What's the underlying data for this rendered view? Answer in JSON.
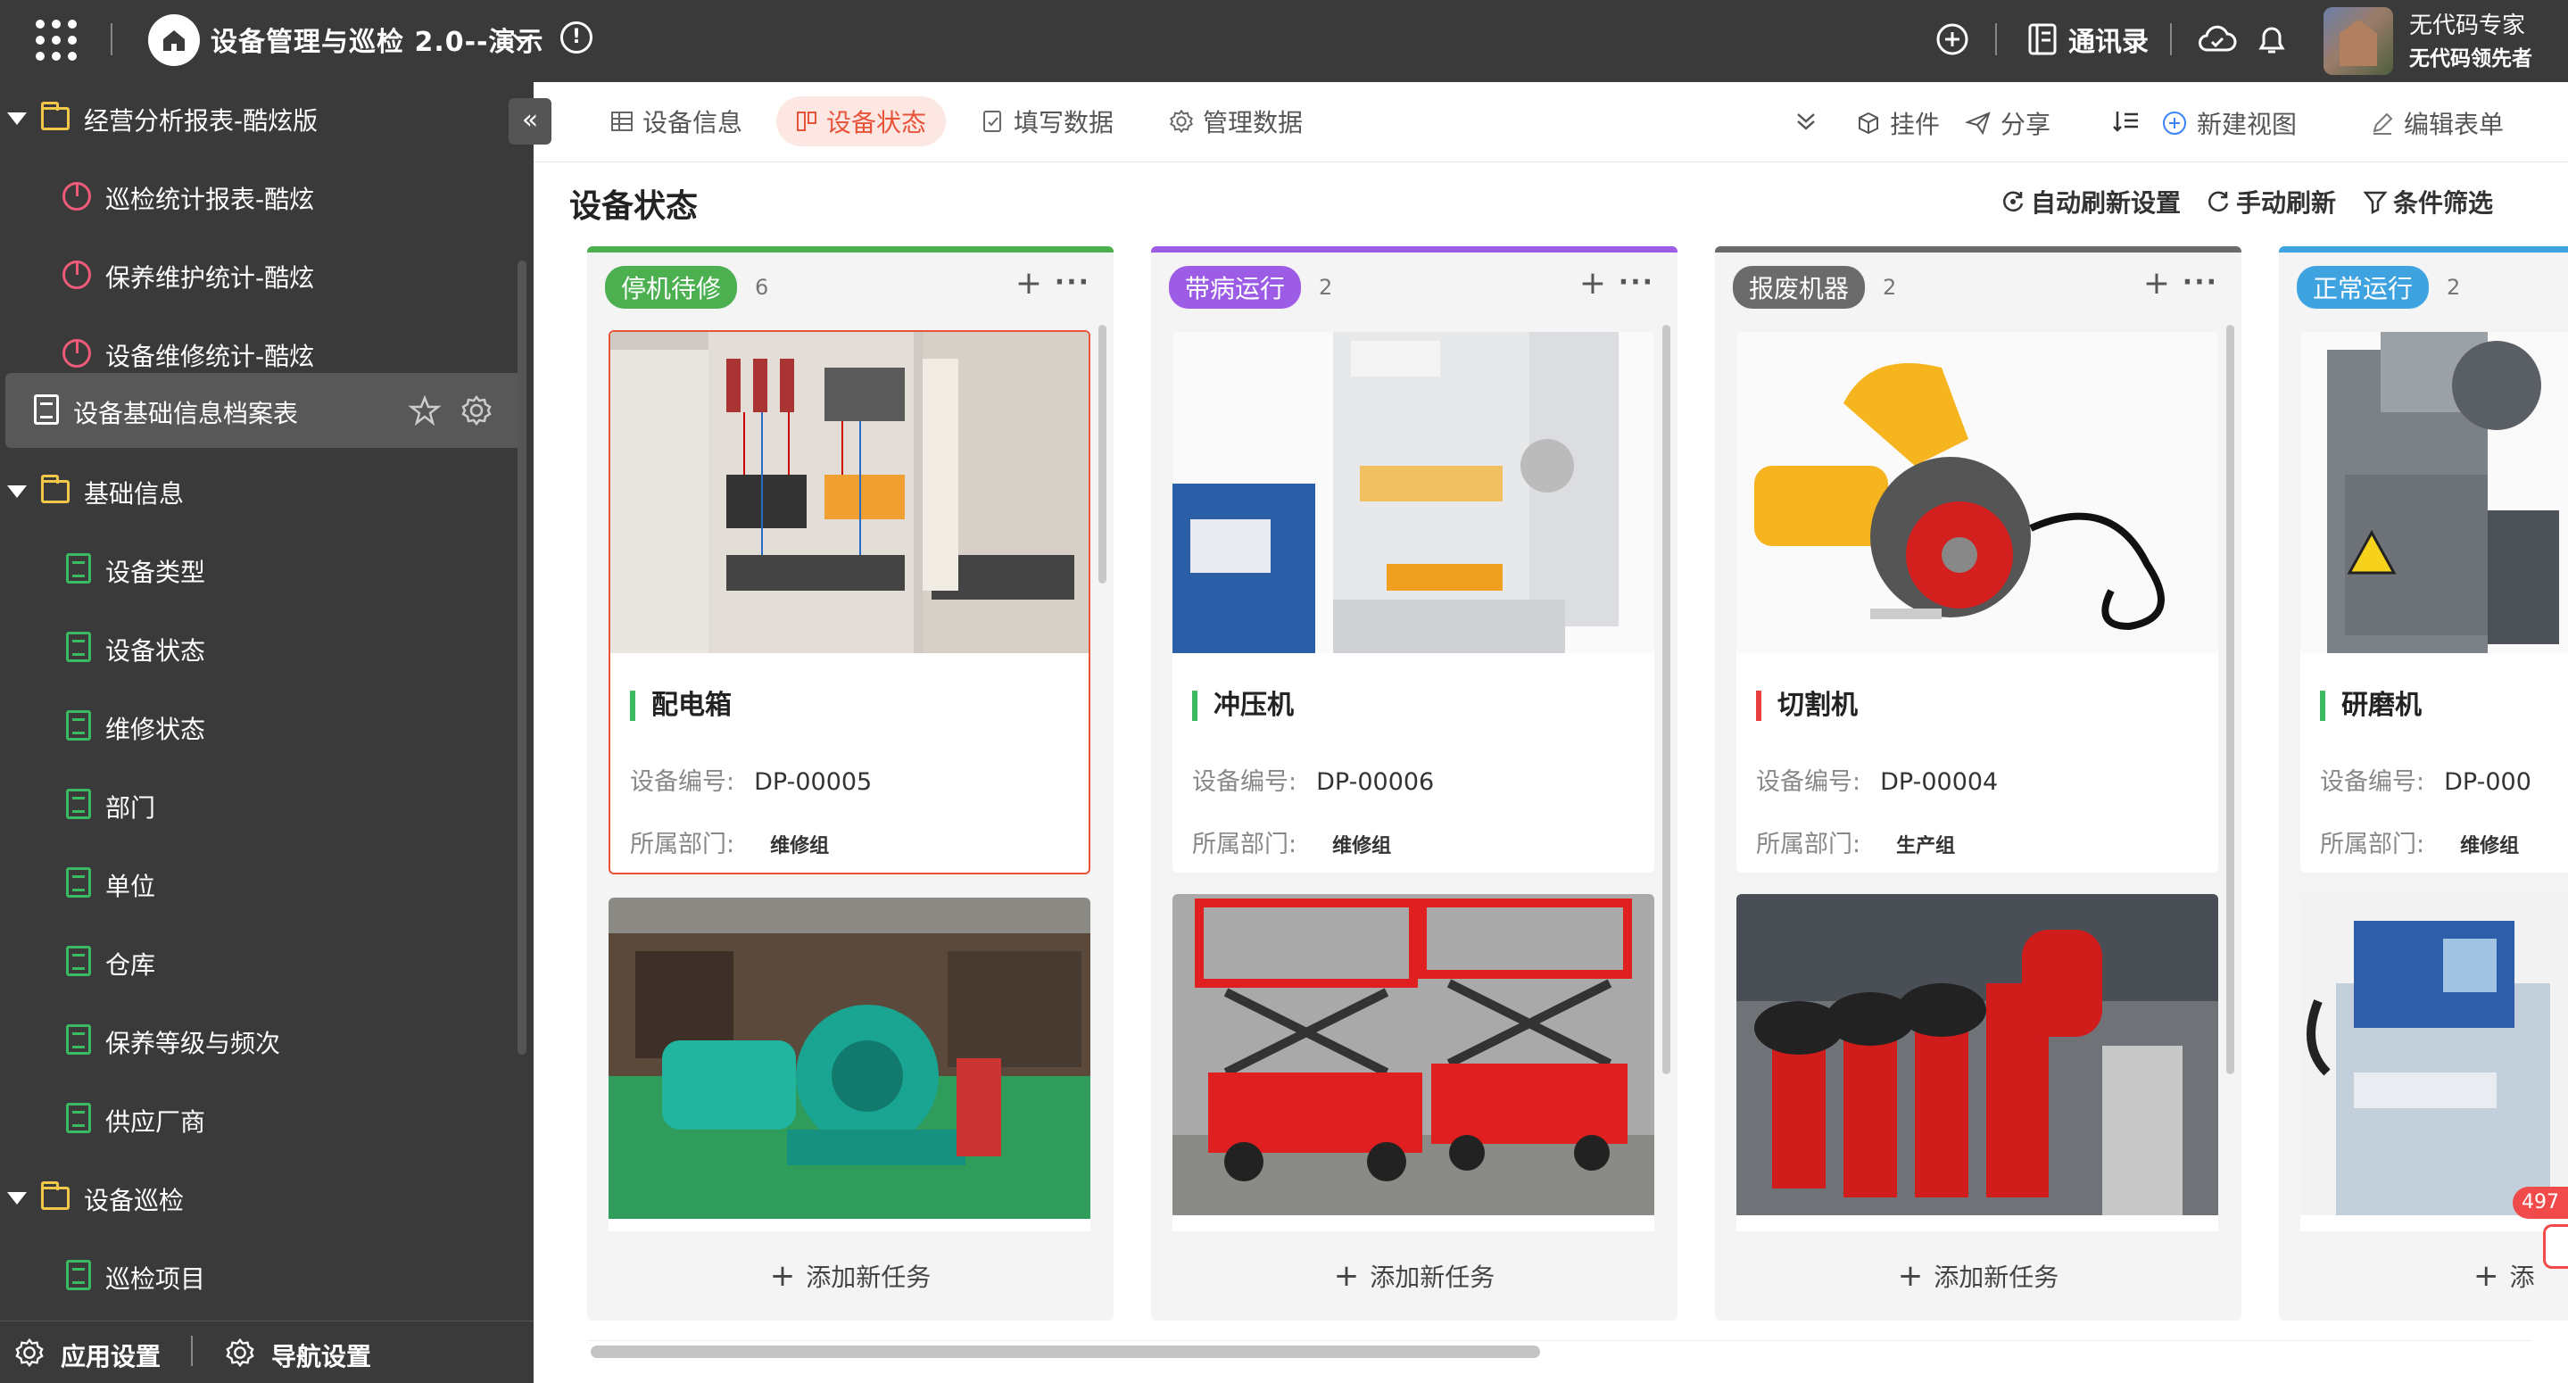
{
  "topbar": {
    "app_title": "设备管理与巡检 2.0--演示",
    "contacts": "通讯录",
    "user_name": "无代码专家",
    "user_subtitle": "无代码领先者"
  },
  "sidebar": {
    "items": [
      {
        "label": "经营分析报表-酷炫版",
        "type": "folder"
      },
      {
        "label": "巡检统计报表-酷炫",
        "type": "report"
      },
      {
        "label": "保养维护统计-酷炫",
        "type": "report"
      },
      {
        "label": "设备维修统计-酷炫",
        "type": "report"
      },
      {
        "label": "设备基础信息档案表",
        "type": "sheet-active"
      },
      {
        "label": "基础信息",
        "type": "folder"
      },
      {
        "label": "设备类型",
        "type": "sheet"
      },
      {
        "label": "设备状态",
        "type": "sheet"
      },
      {
        "label": "维修状态",
        "type": "sheet"
      },
      {
        "label": "部门",
        "type": "sheet"
      },
      {
        "label": "单位",
        "type": "sheet"
      },
      {
        "label": "仓库",
        "type": "sheet"
      },
      {
        "label": "保养等级与频次",
        "type": "sheet"
      },
      {
        "label": "供应厂商",
        "type": "sheet"
      },
      {
        "label": "设备巡检",
        "type": "folder"
      },
      {
        "label": "巡检项目",
        "type": "sheet"
      }
    ],
    "bottom": {
      "app_settings": "应用设置",
      "nav_settings": "导航设置"
    }
  },
  "tabs": [
    "设备信息",
    "设备状态",
    "填写数据",
    "管理数据"
  ],
  "toolbar": {
    "plugins": "挂件",
    "share": "分享",
    "new_view": "新建视图",
    "edit_form": "编辑表单"
  },
  "page": {
    "title": "设备状态",
    "auto_refresh": "自动刷新设置",
    "manual_refresh": "手动刷新",
    "filter": "条件筛选"
  },
  "card_labels": {
    "code": "设备编号:",
    "dept": "所属部门:",
    "add_task": "添加新任务"
  },
  "columns": [
    {
      "name": "停机待修",
      "count": "6",
      "color": "#4caf50",
      "cards": [
        {
          "title": "配电箱",
          "code": "DP-00005",
          "dept": "维修组"
        }
      ]
    },
    {
      "name": "带病运行",
      "count": "2",
      "color": "#9c5ce6",
      "cards": [
        {
          "title": "冲压机",
          "code": "DP-00006",
          "dept": "维修组"
        }
      ]
    },
    {
      "name": "报废机器",
      "count": "2",
      "color": "#6b6b6b",
      "cards": [
        {
          "title": "切割机",
          "code": "DP-00004",
          "dept": "生产组"
        }
      ]
    },
    {
      "name": "正常运行",
      "count": "2",
      "color": "#3fa3e0",
      "cards": [
        {
          "title": "研磨机",
          "code": "DP-000",
          "dept": "维修组"
        }
      ]
    }
  ],
  "add_task_partial": "添",
  "notification_count": "497"
}
